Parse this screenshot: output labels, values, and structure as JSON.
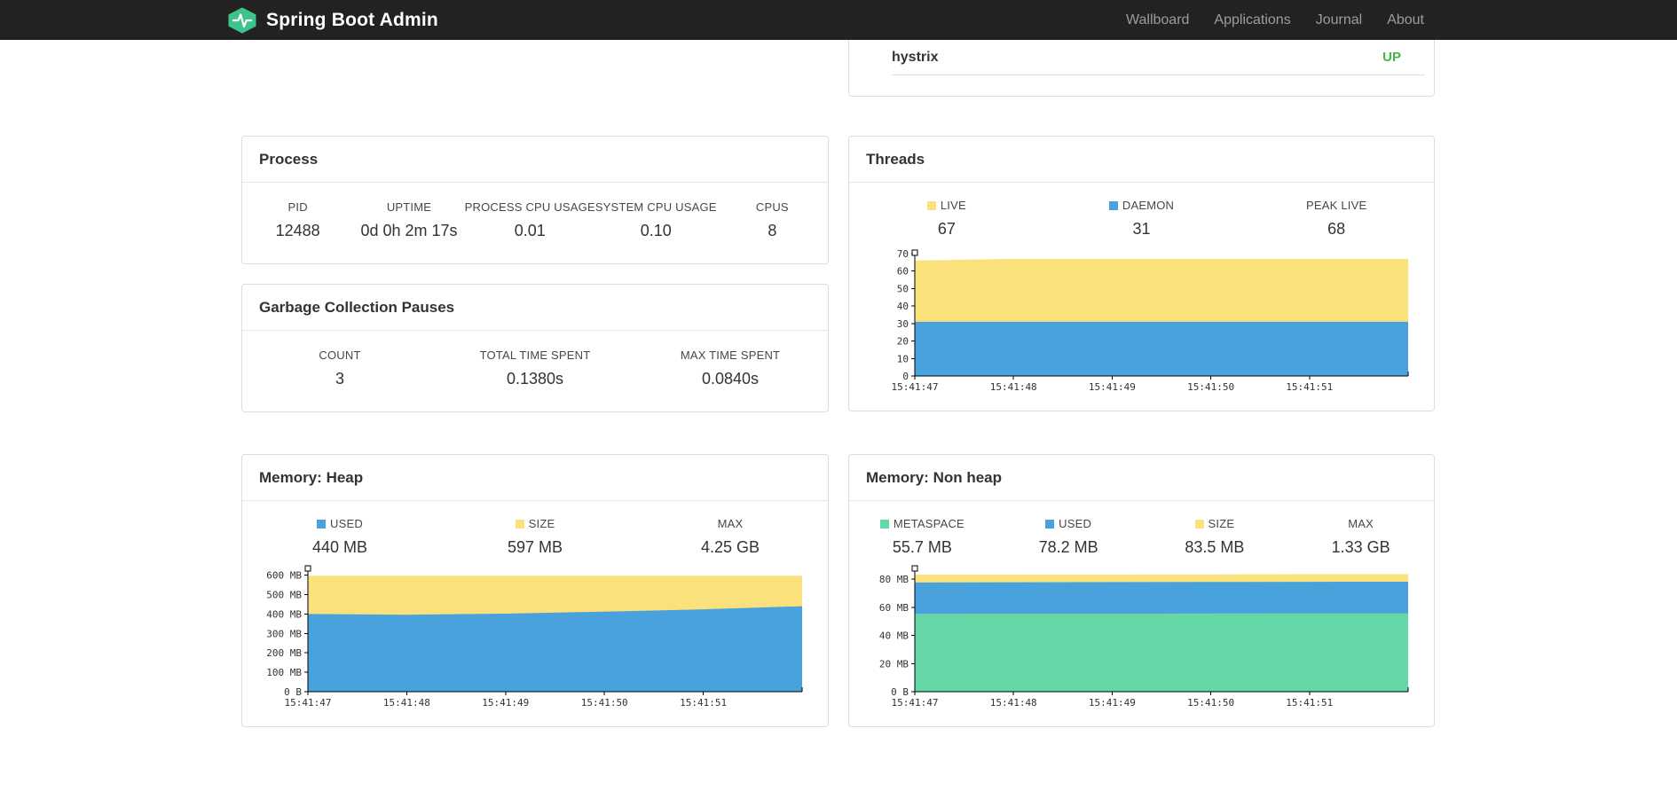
{
  "navbar": {
    "brand": "Spring Boot Admin",
    "items": [
      {
        "label": "Wallboard"
      },
      {
        "label": "Applications"
      },
      {
        "label": "Journal"
      },
      {
        "label": "About"
      }
    ]
  },
  "applications_panel": {
    "row": {
      "name": "hystrix",
      "status": "UP"
    }
  },
  "process_panel": {
    "title": "Process",
    "stats": [
      {
        "label": "PID",
        "value": "12488"
      },
      {
        "label": "UPTIME",
        "value": "0d 0h 2m 17s"
      },
      {
        "label": "PROCESS CPU USAGE",
        "value": "0.01"
      },
      {
        "label": "SYSTEM CPU USAGE",
        "value": "0.10"
      },
      {
        "label": "CPUS",
        "value": "8"
      }
    ]
  },
  "gc_panel": {
    "title": "Garbage Collection Pauses",
    "stats": [
      {
        "label": "COUNT",
        "value": "3"
      },
      {
        "label": "TOTAL TIME SPENT",
        "value": "0.1380s"
      },
      {
        "label": "MAX TIME SPENT",
        "value": "0.0840s"
      }
    ]
  },
  "threads_panel": {
    "title": "Threads",
    "legend": [
      {
        "label": "LIVE",
        "value": "67",
        "color": "#fbe17b"
      },
      {
        "label": "DAEMON",
        "value": "31",
        "color": "#49a2dc"
      },
      {
        "label": "PEAK LIVE",
        "value": "68"
      }
    ]
  },
  "heap_panel": {
    "title": "Memory: Heap",
    "legend": [
      {
        "label": "USED",
        "value": "440 MB",
        "color": "#49a2dc"
      },
      {
        "label": "SIZE",
        "value": "597 MB",
        "color": "#fbe17b"
      },
      {
        "label": "MAX",
        "value": "4.25 GB"
      }
    ]
  },
  "nonheap_panel": {
    "title": "Memory: Non heap",
    "legend": [
      {
        "label": "METASPACE",
        "value": "55.7 MB",
        "color": "#65d7a6"
      },
      {
        "label": "USED",
        "value": "78.2 MB",
        "color": "#49a2dc"
      },
      {
        "label": "SIZE",
        "value": "83.5 MB",
        "color": "#fbe17b"
      },
      {
        "label": "MAX",
        "value": "1.33 GB"
      }
    ]
  },
  "colors": {
    "status_up": "#44b549",
    "navbar_bg": "#222222",
    "brand_green": "#3ec48b",
    "series_blue": "#49a2dc",
    "series_yellow": "#fbe17b",
    "series_green": "#65d7a6"
  },
  "chart_data": [
    {
      "id": "threads",
      "type": "area",
      "title": "Threads",
      "x_labels": [
        "15:41:47",
        "15:41:48",
        "15:41:49",
        "15:41:50",
        "15:41:51"
      ],
      "ylim": [
        0,
        70
      ],
      "grid": false,
      "legend_position": "top",
      "yticks": [
        {
          "v": 0,
          "label": "0"
        },
        {
          "v": 10,
          "label": "10"
        },
        {
          "v": 20,
          "label": "20"
        },
        {
          "v": 30,
          "label": "30"
        },
        {
          "v": 40,
          "label": "40"
        },
        {
          "v": 50,
          "label": "50"
        },
        {
          "v": 60,
          "label": "60"
        },
        {
          "v": 70,
          "label": "70"
        }
      ],
      "series": [
        {
          "name": "LIVE",
          "color": "#fbe17b",
          "values": [
            66,
            67,
            67,
            67,
            67,
            67
          ]
        },
        {
          "name": "DAEMON",
          "color": "#49a2dc",
          "values": [
            31,
            31,
            31,
            31,
            31,
            31
          ]
        }
      ]
    },
    {
      "id": "memory-heap",
      "type": "area",
      "title": "Memory: Heap",
      "x_labels": [
        "15:41:47",
        "15:41:48",
        "15:41:49",
        "15:41:50",
        "15:41:51"
      ],
      "ylim": [
        0,
        630
      ],
      "grid": false,
      "legend_position": "top",
      "yticks": [
        {
          "v": 0,
          "label": "0 B"
        },
        {
          "v": 100,
          "label": "100 MB"
        },
        {
          "v": 200,
          "label": "200 MB"
        },
        {
          "v": 300,
          "label": "300 MB"
        },
        {
          "v": 400,
          "label": "400 MB"
        },
        {
          "v": 500,
          "label": "500 MB"
        },
        {
          "v": 600,
          "label": "600 MB"
        }
      ],
      "series": [
        {
          "name": "SIZE",
          "color": "#fbe17b",
          "values": [
            597,
            597,
            597,
            597,
            597,
            597
          ]
        },
        {
          "name": "USED",
          "color": "#49a2dc",
          "values": [
            400,
            396,
            402,
            412,
            424,
            440
          ]
        }
      ]
    },
    {
      "id": "memory-nonheap",
      "type": "area",
      "title": "Memory: Non heap",
      "x_labels": [
        "15:41:47",
        "15:41:48",
        "15:41:49",
        "15:41:50",
        "15:41:51"
      ],
      "ylim": [
        0,
        87
      ],
      "grid": false,
      "legend_position": "top",
      "yticks": [
        {
          "v": 0,
          "label": "0 B"
        },
        {
          "v": 20,
          "label": "20 MB"
        },
        {
          "v": 40,
          "label": "40 MB"
        },
        {
          "v": 60,
          "label": "60 MB"
        },
        {
          "v": 80,
          "label": "80 MB"
        }
      ],
      "series": [
        {
          "name": "SIZE",
          "color": "#fbe17b",
          "values": [
            83.1,
            83.2,
            83.3,
            83.4,
            83.5,
            83.5
          ]
        },
        {
          "name": "USED",
          "color": "#49a2dc",
          "values": [
            77.6,
            77.8,
            77.9,
            78.0,
            78.1,
            78.2
          ]
        },
        {
          "name": "METASPACE",
          "color": "#65d7a6",
          "values": [
            55.4,
            55.5,
            55.5,
            55.6,
            55.7,
            55.7
          ]
        }
      ]
    }
  ]
}
